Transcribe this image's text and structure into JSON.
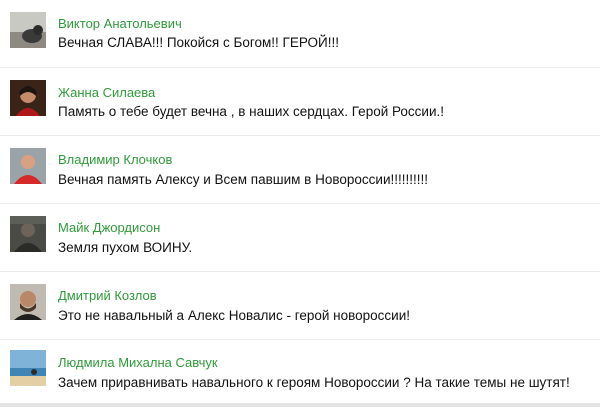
{
  "comments": [
    {
      "author": "Виктор Анатольевич",
      "text": "Вечная СЛАВА!!! Покойся с Богом!! ГЕРОЙ!!!",
      "avatar_icon": "user-photo-cat"
    },
    {
      "author": "Жанна Силаева",
      "text": "Память о тебе будет вечна , в наших сердцах. Герой России.!",
      "avatar_icon": "user-photo-woman"
    },
    {
      "author": "Владимир Клочков",
      "text": "Вечная память Алексу и Всем павшим в Новороссии!!!!!!!!!!",
      "avatar_icon": "user-photo-man-red"
    },
    {
      "author": "Майк Джордисон",
      "text": "Земля пухом ВОИНУ.",
      "avatar_icon": "user-photo-soldier"
    },
    {
      "author": "Дмитрий Козлов",
      "text": "Это не навальный а Алекс Новалис - герой новороссии!",
      "avatar_icon": "user-photo-bearded-man"
    },
    {
      "author": "Людмила Михална Савчук",
      "text": "Зачем приравнивать навального к героям Новороссии ? На такие темы не шутят!",
      "avatar_icon": "user-photo-beach"
    }
  ],
  "colors": {
    "author": "#2f9a3a",
    "text": "#111111",
    "divider": "#ececec"
  }
}
